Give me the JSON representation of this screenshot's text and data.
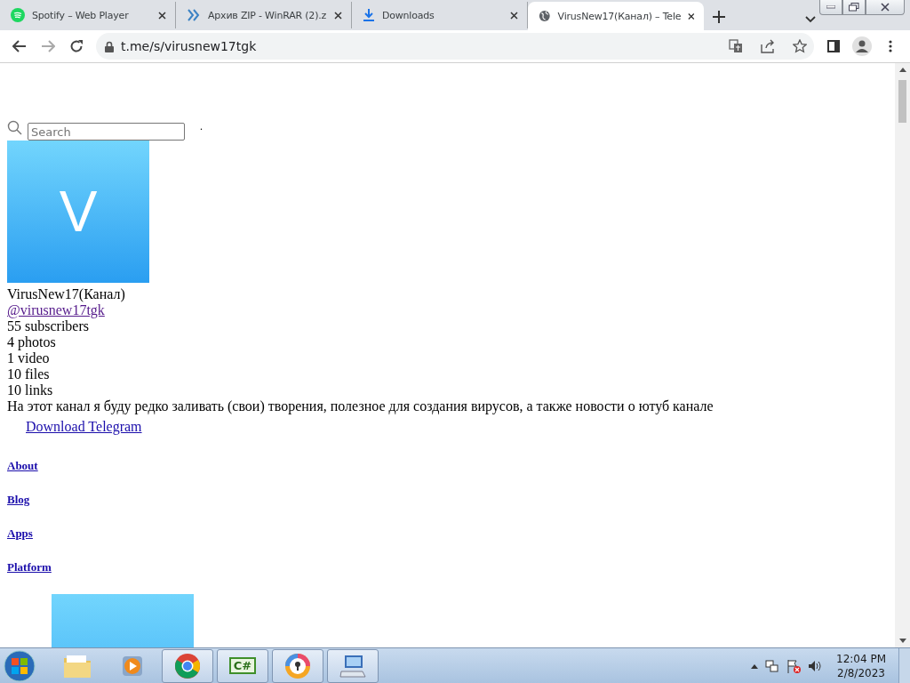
{
  "tabs": [
    {
      "kind": "spotify",
      "title": "Spotify – Web Player",
      "selected": false
    },
    {
      "kind": "winrar",
      "title": "Архив ZIP - WinRAR (2).z",
      "selected": false
    },
    {
      "kind": "download",
      "title": "Downloads",
      "selected": false
    },
    {
      "kind": "globe",
      "title": "VirusNew17(Канал) – Tele",
      "selected": true
    }
  ],
  "address_bar": {
    "url": "t.me/s/virusnew17tgk"
  },
  "page": {
    "search": {
      "placeholder": "Search"
    },
    "dot": ".",
    "avatar_letter": "V",
    "channel_name": "VirusNew17(Канал)",
    "username": "@virusnew17tgk",
    "counters": [
      "55 subscribers",
      "4 photos",
      "1 video",
      "10 files",
      "10 links"
    ],
    "description": "На этот канал я буду редко заливать (свои) творения, полезное для создания вирусов, а также новости о ютуб канале",
    "download_link": "Download Telegram",
    "footer_links": [
      "About",
      "Blog",
      "Apps",
      "Platform"
    ]
  },
  "taskbar": {
    "apps": [
      {
        "kind": "explorer"
      },
      {
        "kind": "media"
      },
      {
        "kind": "chrome"
      },
      {
        "kind": "csharp"
      },
      {
        "kind": "avast"
      },
      {
        "kind": "keyboard"
      }
    ],
    "csharp_label": "C#",
    "time": "12:04 PM",
    "date": "2/8/2023"
  }
}
